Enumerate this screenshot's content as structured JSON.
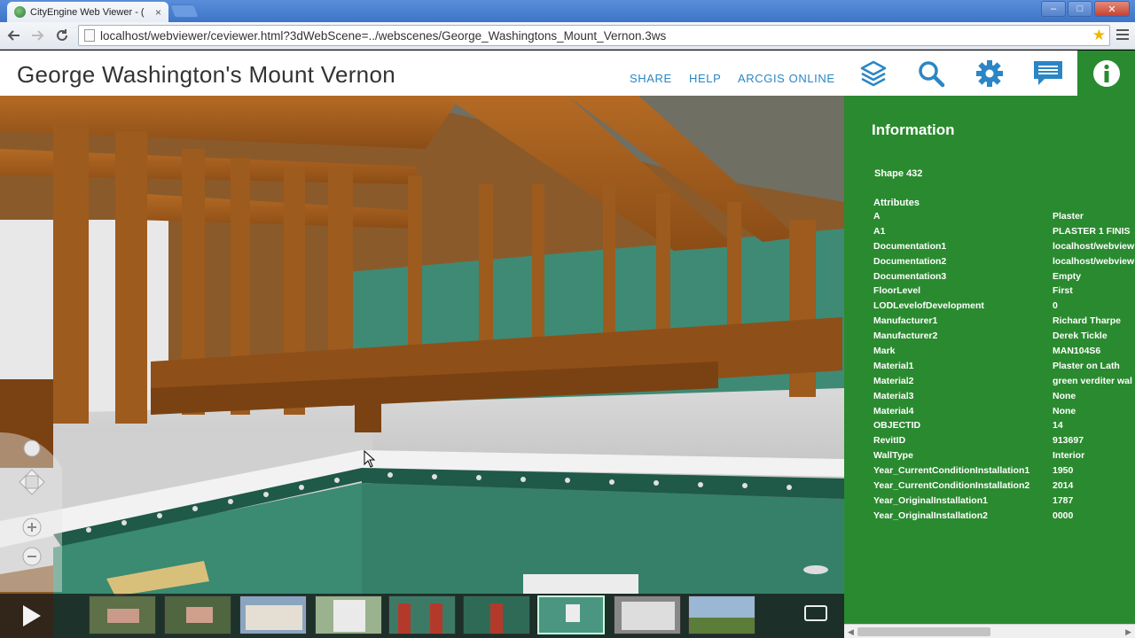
{
  "browser": {
    "tab_title": "CityEngine Web Viewer - (",
    "tab_close": "×",
    "url": "localhost/webviewer/ceviewer.html?3dWebScene=../webscenes/George_Washingtons_Mount_Vernon.3ws",
    "win_min": "–",
    "win_max": "□",
    "win_close": "✕"
  },
  "header": {
    "title": "George Washington's Mount Vernon",
    "links": [
      "SHARE",
      "HELP",
      "ARCGIS ONLINE"
    ],
    "icons": [
      "layers-icon",
      "search-icon",
      "gear-icon",
      "comment-icon",
      "info-icon"
    ],
    "accent": "#2a8a2f",
    "link_color": "#2a86c5"
  },
  "info": {
    "heading": "Information",
    "shape": "Shape 432",
    "attributes_heading": "Attributes",
    "attributes": [
      {
        "key": "A",
        "value": "Plaster"
      },
      {
        "key": "A1",
        "value": "PLASTER 1 FINIS"
      },
      {
        "key": "Documentation1",
        "value": "localhost/webview"
      },
      {
        "key": "Documentation2",
        "value": "localhost/webview"
      },
      {
        "key": "Documentation3",
        "value": "Empty"
      },
      {
        "key": "FloorLevel",
        "value": "First"
      },
      {
        "key": "LODLevelofDevelopment",
        "value": "0"
      },
      {
        "key": "Manufacturer1",
        "value": "Richard Tharpe"
      },
      {
        "key": "Manufacturer2",
        "value": "Derek Tickle"
      },
      {
        "key": "Mark",
        "value": "MAN104S6"
      },
      {
        "key": "Material1",
        "value": "Plaster on Lath"
      },
      {
        "key": "Material2",
        "value": "green verditer wal"
      },
      {
        "key": "Material3",
        "value": "None"
      },
      {
        "key": "Material4",
        "value": "None"
      },
      {
        "key": "OBJECTID",
        "value": "14"
      },
      {
        "key": "RevitID",
        "value": "913697"
      },
      {
        "key": "WallType",
        "value": "Interior"
      },
      {
        "key": "Year_CurrentConditionInstallation1",
        "value": "1950"
      },
      {
        "key": "Year_CurrentConditionInstallation2",
        "value": "2014"
      },
      {
        "key": "Year_OriginalInstallation1",
        "value": "1787"
      },
      {
        "key": "Year_OriginalInstallation2",
        "value": "0000"
      }
    ]
  },
  "filmstrip": {
    "thumbnails": [
      "aerial",
      "aerial-2",
      "mansion-front",
      "portico",
      "red-doors",
      "green-room",
      "green-room-selected",
      "window-frame",
      "landscape"
    ],
    "selected_index": 6
  }
}
